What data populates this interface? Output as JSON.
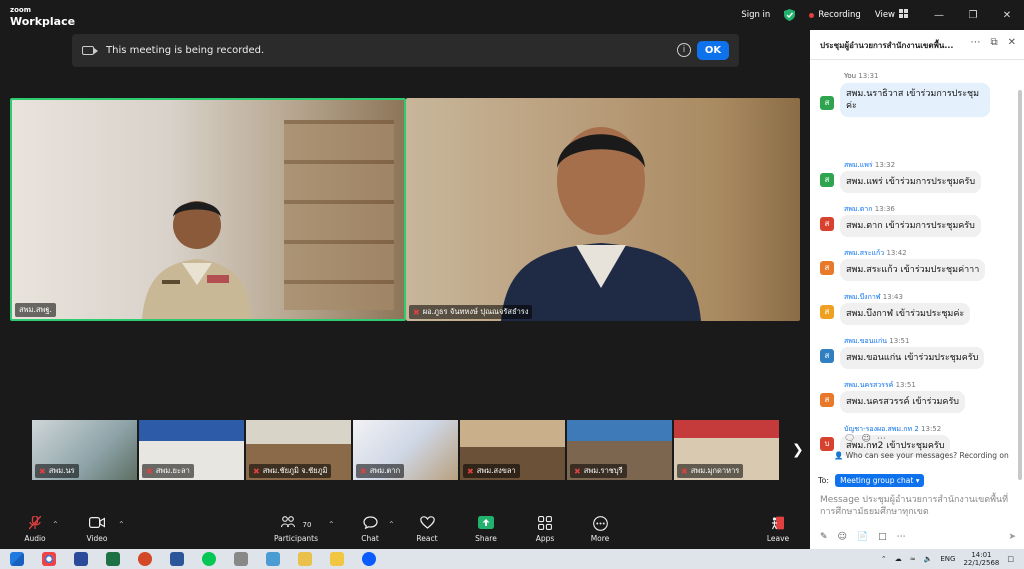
{
  "window": {
    "logo_line1": "zoom",
    "logo_line2": "Workplace",
    "sign_in": "Sign in",
    "recording": "Recording",
    "view": "View"
  },
  "banner": {
    "text": "This meeting is being recorded.",
    "ok": "OK"
  },
  "video": {
    "left_name": "สพม.สพฐ.",
    "right_name": "ผอ.ภูธร จันทหงษ์ ปุณณจรัสธำรง"
  },
  "thumbnails": [
    {
      "name": "สพม.นร"
    },
    {
      "name": "สพม.ยะลา"
    },
    {
      "name": "สพม.ชัยภูมิ จ.ชัยภูมิ"
    },
    {
      "name": "สพม.ตาก"
    },
    {
      "name": "สพม.สงขลา"
    },
    {
      "name": "สพม.ราชบุรี"
    },
    {
      "name": "สพม.มุกดาหาร"
    }
  ],
  "toolbar": {
    "audio": "Audio",
    "video": "Video",
    "participants": "Participants",
    "participants_count": "70",
    "chat": "Chat",
    "react": "React",
    "share": "Share",
    "apps": "Apps",
    "more": "More",
    "leave": "Leave"
  },
  "chat": {
    "title": "ประชุมผู้อำนวยการสำนักงานเขตพื้น...",
    "messages": [
      {
        "sender": "You",
        "time": "13:31",
        "text": "สพม.นราธิวาส เข้าร่วมการประชุมค่ะ",
        "avatar": "ส",
        "color": "#2ea44f"
      },
      {
        "sender": "สพม.แพร่",
        "time": "13:32",
        "text": "สพม.แพร่ เข้าร่วมการประชุมครับ",
        "avatar": "ส",
        "color": "#2ea44f"
      },
      {
        "sender": "สพม.ตาก",
        "time": "13:36",
        "text": "สพม.ตาก เข้าร่วมการประชุมครับ",
        "avatar": "ส",
        "color": "#d9412f"
      },
      {
        "sender": "สพม.สระแก้ว",
        "time": "13:42",
        "text": "สพม.สระแก้ว เข้าร่วมประชุมค่าาา",
        "avatar": "ส",
        "color": "#e8792b"
      },
      {
        "sender": "สพม.บึงกาฬ",
        "time": "13:43",
        "text": "สพม.บึงกาฬ เข้าร่วมประชุมค่ะ",
        "avatar": "ส",
        "color": "#f0a020"
      },
      {
        "sender": "สพม.ขอนแก่น",
        "time": "13:51",
        "text": "สพม.ขอนแก่น เข้าร่วมประชุมครับ",
        "avatar": "ส",
        "color": "#2f7fc1"
      },
      {
        "sender": "สพม.นครสวรรค์",
        "time": "13:51",
        "text": "สพม.นครสวรรค์ เข้าร่วมครับ",
        "avatar": "ส",
        "color": "#e8792b"
      },
      {
        "sender": "บัญชา-รองผอ.สพม.กท 2",
        "time": "13:52",
        "text": "สพม.กท2 เข้าประชุมครับ",
        "avatar": "บ",
        "color": "#d9412f"
      }
    ],
    "who_can_see": "Who can see your messages? Recording on",
    "to_label": "To:",
    "to_value": "Meeting group chat",
    "compose_placeholder": "Message ประชุมผู้อำนวยการสำนักงานเขตพื้นที่การศึกษามัธยมศึกษาทุกเขต"
  },
  "taskbar": {
    "lang": "ENG",
    "time": "14:01",
    "date": "22/1/2568"
  }
}
